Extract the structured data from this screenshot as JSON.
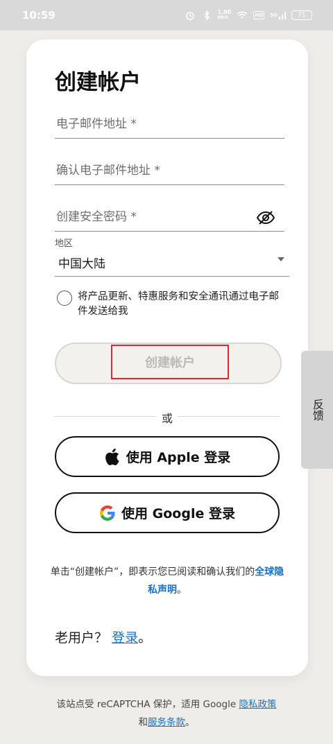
{
  "status_bar": {
    "time": "10:59",
    "speed": "1.00",
    "speed_unit": "KB/S",
    "network": "5G",
    "battery": "71"
  },
  "form": {
    "title": "创建帐户",
    "email_placeholder": "电子邮件地址 *",
    "confirm_email_placeholder": "确认电子邮件地址 *",
    "password_placeholder": "创建安全密码 *",
    "region_label": "地区",
    "region_value": "中国大陆",
    "consent_text": "将产品更新、特惠服务和安全通讯通过电子邮件发送给我",
    "create_button": "创建帐户",
    "or_text": "或",
    "apple_button": "使用 Apple 登录",
    "google_button": "使用 Google 登录",
    "disclaimer_prefix": "单击“创建帐户”，即表示您已阅读和确认我们的",
    "privacy_link": "全球隐私声明",
    "disclaimer_suffix": "。",
    "returning_prefix": "老用户？",
    "login_link": "登录",
    "returning_suffix": "。"
  },
  "feedback": {
    "label": "反馈"
  },
  "footer": {
    "line1_prefix": "该站点受 reCAPTCHA 保护，适用 Google ",
    "privacy_policy": "隐私政策",
    "line2_prefix": "和",
    "terms": "服务条款",
    "line2_suffix": "。"
  },
  "colors": {
    "accent_link": "#1f6fb8",
    "highlight_box": "#e0262c",
    "page_bg": "#efedea"
  }
}
